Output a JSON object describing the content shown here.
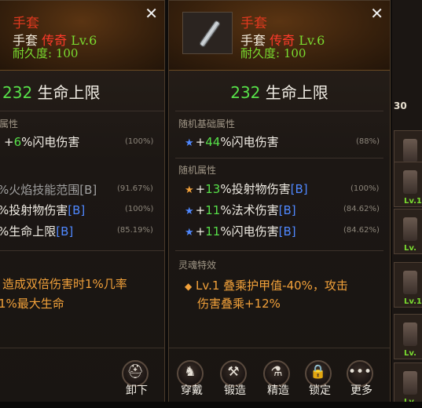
{
  "left_panel": {
    "close_symbol": "✕",
    "item_name": "手套",
    "type": "手套",
    "rarity": "传奇",
    "level": "Lv.6",
    "durability_label": "耐久度:",
    "durability_value": "100",
    "main_value": "232",
    "main_label": "生命上限",
    "section_base": "属性",
    "base_rows": [
      {
        "plus": "+",
        "value": "6",
        "label": "%闪电伤害",
        "pct": "(100%)"
      }
    ],
    "rand_rows": [
      {
        "text": "%火焰技能范围",
        "tag": "[B]",
        "pct": "(91.67%)"
      },
      {
        "text": "%投射物伤害",
        "tag": "[B]",
        "pct": "(100%)"
      },
      {
        "text": "%生命上限",
        "tag": "[B]",
        "pct": "(85.19%)"
      }
    ],
    "soul_line1": "造成双倍伤害时1%几率",
    "soul_line2": "1%最大生命",
    "button_unequip": "卸下"
  },
  "right_panel": {
    "close_symbol": "✕",
    "item_name": "手套",
    "type": "手套",
    "rarity": "传奇",
    "level": "Lv.6",
    "durability_label": "耐久度:",
    "durability_value": "100",
    "main_value": "232",
    "main_label": "生命上限",
    "section_base": "随机基础属性",
    "base_rows": [
      {
        "star": "★",
        "plus": "+",
        "value": "44",
        "label": "%闪电伤害",
        "pct": "(88%)"
      }
    ],
    "section_rand": "随机属性",
    "rand_rows": [
      {
        "star": "★",
        "plus": "+",
        "value": "13",
        "label": "%投射物伤害",
        "tag": "[B]",
        "pct": "(100%)"
      },
      {
        "star": "★",
        "plus": "+",
        "value": "11",
        "label": "%法术伤害",
        "tag": "[B]",
        "pct": "(84.62%)"
      },
      {
        "star": "★",
        "plus": "+",
        "value": "11",
        "label": "%闪电伤害",
        "tag": "[B]",
        "pct": "(84.62%)"
      }
    ],
    "section_soul": "灵魂特效",
    "soul_bullet": "◆",
    "soul_line1": "Lv.1 叠乘护甲值-40%，攻击",
    "soul_line2": "伤害叠乘+12%",
    "buttons": [
      {
        "label": "穿戴"
      },
      {
        "label": "锻造"
      },
      {
        "label": "精造"
      },
      {
        "label": "锁定"
      },
      {
        "label": "更多"
      }
    ]
  },
  "inventory_strip": {
    "count": "30",
    "slots": [
      {
        "level": ""
      },
      {
        "level": "Lv.1"
      },
      {
        "level": "Lv."
      },
      {
        "level": "Lv.1"
      },
      {
        "level": "Lv."
      },
      {
        "level": "Lv."
      }
    ]
  },
  "colors": {
    "green": "#57e049",
    "blue": "#4f88ff",
    "orange": "#f2a13a",
    "red": "#e0391f",
    "lime": "#7adc30"
  },
  "icons": [
    "close-icon",
    "gauntlet-icon",
    "star-icon",
    "unequip-icon",
    "equip-icon",
    "forge-icon",
    "refine-icon",
    "lock-icon",
    "more-icon"
  ]
}
